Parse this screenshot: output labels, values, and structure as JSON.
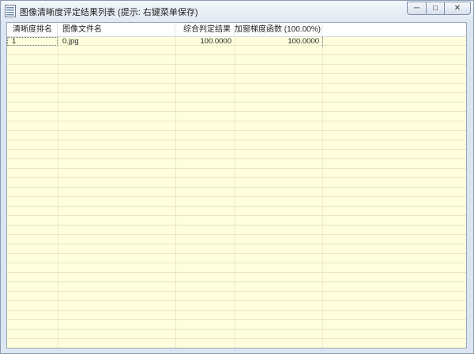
{
  "window": {
    "title": "图像清晰度评定结果列表 (提示: 右键菜单保存)",
    "controls": {
      "minimize": "─",
      "maximize": "□",
      "close": "✕"
    }
  },
  "table": {
    "columns": [
      "清晰度排名",
      "图像文件名",
      "综合判定结果",
      "加窗梯度函数 (100.00%)"
    ],
    "rows": [
      {
        "rank": "1",
        "file": "0.jpg",
        "result": "100.0000",
        "gradient": "100.0000"
      }
    ]
  }
}
